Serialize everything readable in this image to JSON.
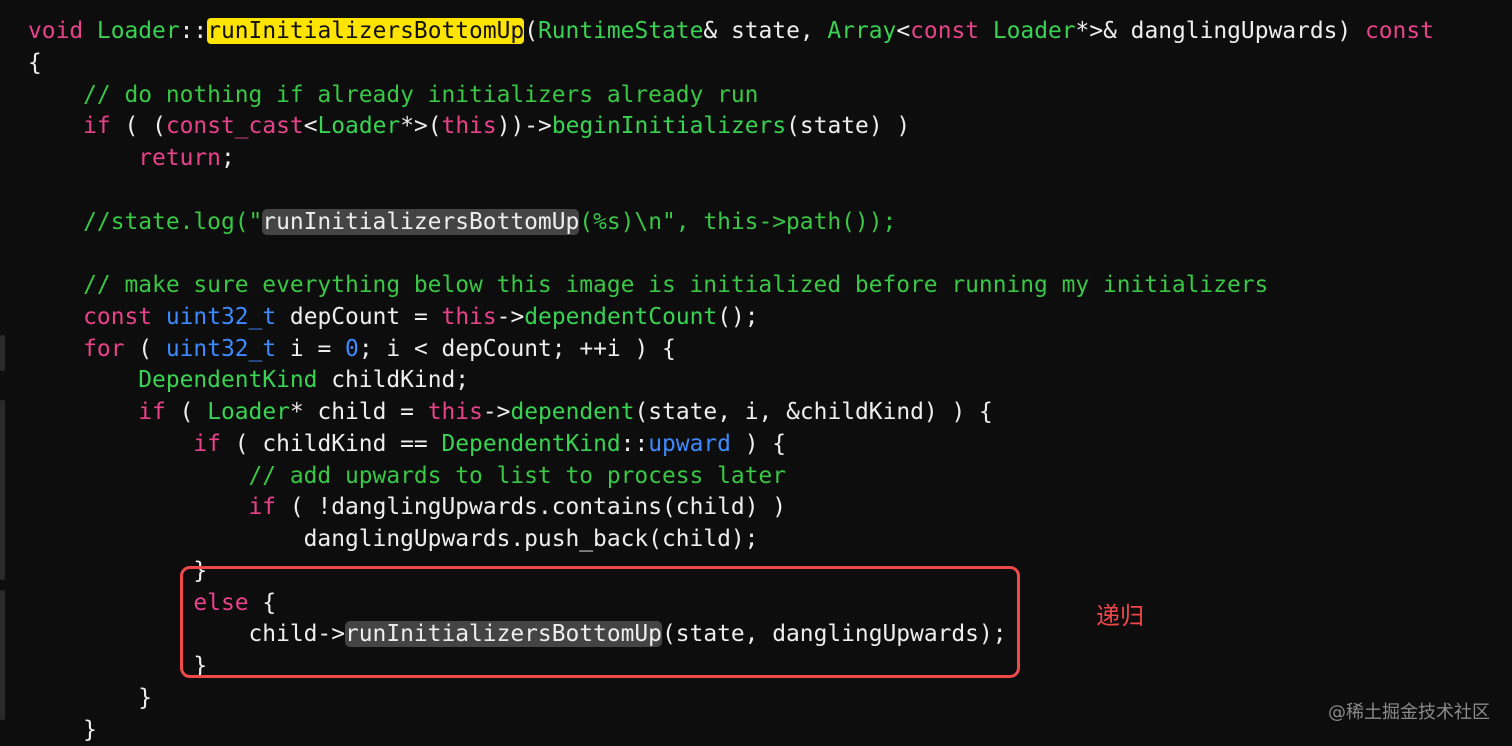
{
  "code": {
    "lines": [
      [
        {
          "t": "void ",
          "k": "keyword"
        },
        {
          "t": "Loader",
          "k": "type"
        },
        {
          "t": "::",
          "k": "plain"
        },
        {
          "t": "runInitializersBottomUp",
          "k": "hl"
        },
        {
          "t": "(",
          "k": "plain"
        },
        {
          "t": "RuntimeState",
          "k": "type"
        },
        {
          "t": "& state, ",
          "k": "plain"
        },
        {
          "t": "Array",
          "k": "type"
        },
        {
          "t": "<",
          "k": "plain"
        },
        {
          "t": "const ",
          "k": "keyword"
        },
        {
          "t": "Loader",
          "k": "type"
        },
        {
          "t": "*>& danglingUpwards) ",
          "k": "plain"
        },
        {
          "t": "const",
          "k": "keyword"
        }
      ],
      [
        {
          "t": "{",
          "k": "plain"
        }
      ],
      [
        {
          "t": "    // do nothing if already initializers already run",
          "k": "comment"
        }
      ],
      [
        {
          "t": "    ",
          "k": "plain"
        },
        {
          "t": "if",
          "k": "keyword"
        },
        {
          "t": " ( (",
          "k": "plain"
        },
        {
          "t": "const_cast",
          "k": "keyword"
        },
        {
          "t": "<",
          "k": "plain"
        },
        {
          "t": "Loader",
          "k": "type"
        },
        {
          "t": "*>(",
          "k": "plain"
        },
        {
          "t": "this",
          "k": "keyword"
        },
        {
          "t": "))->",
          "k": "plain"
        },
        {
          "t": "beginInitializers",
          "k": "func"
        },
        {
          "t": "(state) )",
          "k": "plain"
        }
      ],
      [
        {
          "t": "        ",
          "k": "plain"
        },
        {
          "t": "return",
          "k": "keyword"
        },
        {
          "t": ";",
          "k": "plain"
        }
      ],
      [],
      [
        {
          "t": "    //state.log(\"",
          "k": "comment"
        },
        {
          "t": "runInitializersBottomUp",
          "k": "sel"
        },
        {
          "t": "(%s)\\n\", this->path());",
          "k": "comment"
        }
      ],
      [],
      [
        {
          "t": "    // make sure everything below this image is initialized before running my initializers",
          "k": "comment"
        }
      ],
      [
        {
          "t": "    ",
          "k": "plain"
        },
        {
          "t": "const ",
          "k": "keyword"
        },
        {
          "t": "uint32_t",
          "k": "builtin"
        },
        {
          "t": " ",
          "k": "plain"
        },
        {
          "t": "depCount",
          "k": "squiggle"
        },
        {
          "t": " = ",
          "k": "plain"
        },
        {
          "t": "this",
          "k": "keyword"
        },
        {
          "t": "->",
          "k": "plain"
        },
        {
          "t": "dependentCount",
          "k": "func"
        },
        {
          "t": "();",
          "k": "plain"
        }
      ],
      [
        {
          "t": "    ",
          "k": "plain"
        },
        {
          "t": "for",
          "k": "keyword"
        },
        {
          "t": " ( ",
          "k": "plain"
        },
        {
          "t": "uint32_t",
          "k": "builtin"
        },
        {
          "t": " i = ",
          "k": "plain"
        },
        {
          "t": "0",
          "k": "number"
        },
        {
          "t": "; i < depCount; ++i ) {",
          "k": "plain"
        }
      ],
      [
        {
          "t": "        ",
          "k": "plain"
        },
        {
          "t": "DependentKind",
          "k": "type"
        },
        {
          "t": " childKind;",
          "k": "plain"
        }
      ],
      [
        {
          "t": "        ",
          "k": "plain"
        },
        {
          "t": "if",
          "k": "keyword"
        },
        {
          "t": " ( ",
          "k": "plain"
        },
        {
          "t": "Loader",
          "k": "type"
        },
        {
          "t": "* child = ",
          "k": "plain"
        },
        {
          "t": "this",
          "k": "keyword"
        },
        {
          "t": "->",
          "k": "plain"
        },
        {
          "t": "dependent",
          "k": "func"
        },
        {
          "t": "(state, i, &childKind) ) {",
          "k": "plain"
        }
      ],
      [
        {
          "t": "            ",
          "k": "plain"
        },
        {
          "t": "if",
          "k": "keyword"
        },
        {
          "t": " ( childKind == ",
          "k": "plain"
        },
        {
          "t": "DependentKind",
          "k": "type"
        },
        {
          "t": "::",
          "k": "plain"
        },
        {
          "t": "upward",
          "k": "builtin"
        },
        {
          "t": " ) {",
          "k": "plain"
        }
      ],
      [
        {
          "t": "                // add upwards to list to process later",
          "k": "comment"
        }
      ],
      [
        {
          "t": "                ",
          "k": "plain"
        },
        {
          "t": "if",
          "k": "keyword"
        },
        {
          "t": " ( !danglingUpwards.",
          "k": "plain"
        },
        {
          "t": "contains",
          "k": "plain"
        },
        {
          "t": "(child) )",
          "k": "plain"
        }
      ],
      [
        {
          "t": "                    danglingUpwards.push_back(child);",
          "k": "plain"
        }
      ],
      [
        {
          "t": "            }",
          "k": "plain"
        }
      ],
      [
        {
          "t": "            ",
          "k": "plain"
        },
        {
          "t": "else",
          "k": "keyword"
        },
        {
          "t": " {",
          "k": "plain"
        }
      ],
      [
        {
          "t": "                child->",
          "k": "plain"
        },
        {
          "t": "runInitializersBottomUp",
          "k": "sel"
        },
        {
          "t": "(state, danglingUpwards);",
          "k": "plain"
        }
      ],
      [
        {
          "t": "            }",
          "k": "plain"
        }
      ],
      [
        {
          "t": "        }",
          "k": "plain"
        }
      ],
      [
        {
          "t": "    }",
          "k": "plain"
        }
      ]
    ]
  },
  "annotation": {
    "label": "递归",
    "color": "#ef4a4a"
  },
  "watermark": {
    "text": "@稀土掘金技术社区"
  },
  "theme": {
    "background": "#0d0d0d",
    "keyword": "#e8438a",
    "type": "#39d353",
    "comment": "#39c745",
    "builtin": "#3d8bff",
    "highlight": "#ffe400",
    "selection": "#444444"
  }
}
